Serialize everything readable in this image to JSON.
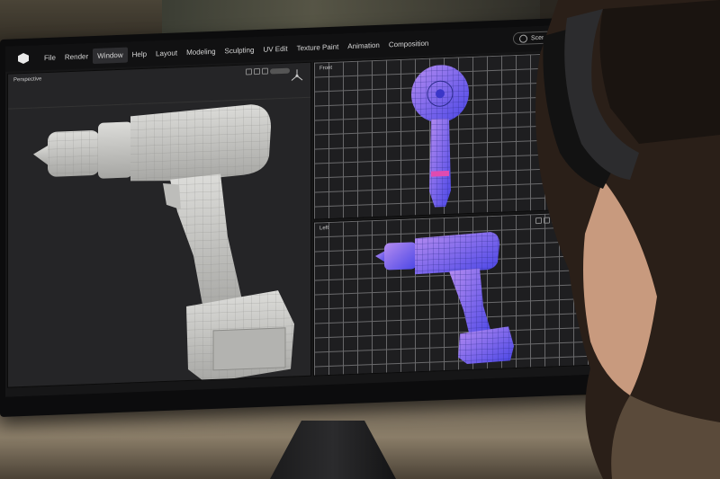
{
  "app": {
    "menu": [
      "File",
      "Render",
      "Window",
      "Help",
      "Layout",
      "Modeling",
      "Sculpting",
      "UV Edit",
      "Texture Paint",
      "Animation",
      "Composition"
    ],
    "active_menu": "Window",
    "scene_label": "Scene"
  },
  "viewports": {
    "perspective": {
      "label": "Perspective"
    },
    "front": {
      "label": "Front"
    },
    "left": {
      "label": "Left"
    }
  },
  "colors": {
    "model_solid": "#c9c9c6",
    "wire_blue": "#5a4ff0",
    "wire_violet": "#b58cf0"
  },
  "icons": [
    "app-logo-icon",
    "scene-icon",
    "axis-gizmo-icon"
  ]
}
